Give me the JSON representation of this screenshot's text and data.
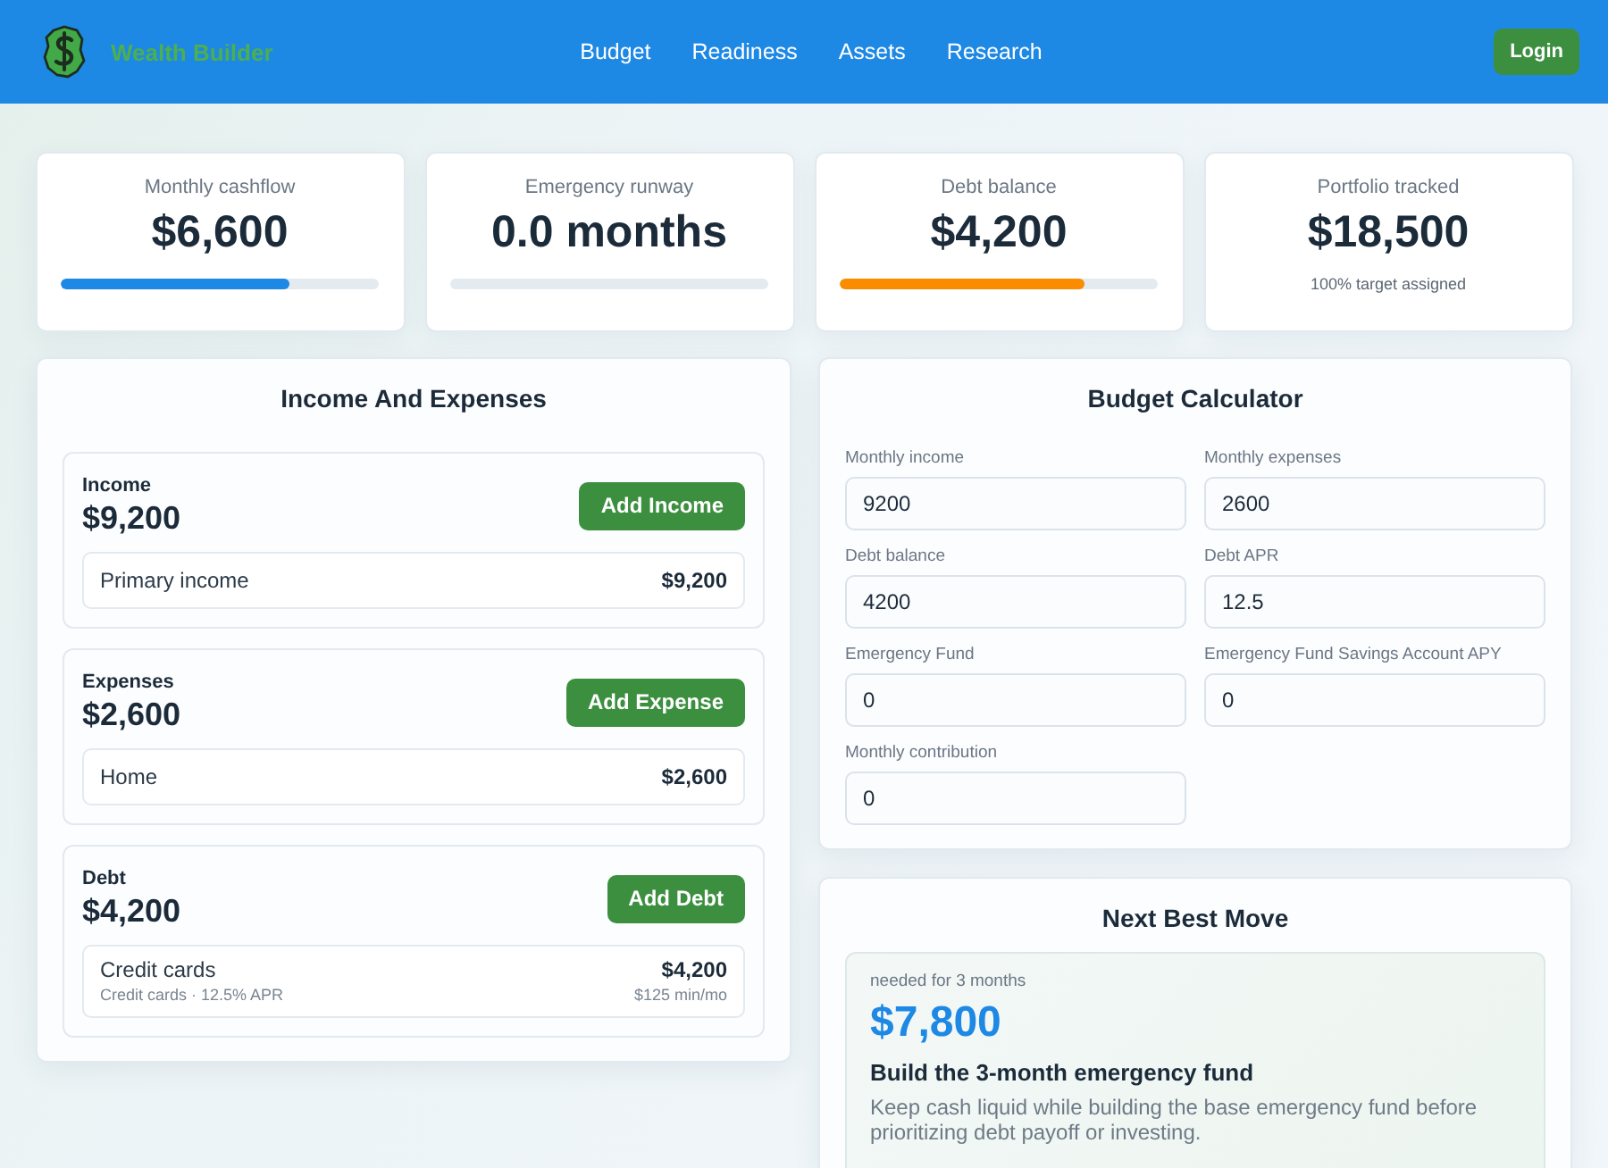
{
  "header": {
    "brand": "Wealth Builder",
    "nav": [
      "Budget",
      "Readiness",
      "Assets",
      "Research"
    ],
    "login": "Login"
  },
  "stats": [
    {
      "label": "Monthly cashflow",
      "value": "$6,600",
      "kind": "bar",
      "level": 0.72,
      "color": "#1e88e5"
    },
    {
      "label": "Emergency runway",
      "value": "0.0 months",
      "kind": "bar"
    },
    {
      "label": "Debt balance",
      "value": "$4,200",
      "kind": "bar",
      "level": 0.77,
      "color": "#fb8c00"
    },
    {
      "label": "Portfolio tracked",
      "value": "$18,500",
      "kind": "note",
      "note": "100% target assigned"
    }
  ],
  "ledger": {
    "title": "Income And Expenses",
    "sections": [
      {
        "label": "Income",
        "total": "$9,200",
        "button": "Add Income",
        "items": [
          {
            "name": "Primary income",
            "amount": "$9,200"
          }
        ]
      },
      {
        "label": "Expenses",
        "total": "$2,600",
        "button": "Add Expense",
        "items": [
          {
            "name": "Home",
            "amount": "$2,600"
          }
        ]
      },
      {
        "label": "Debt",
        "total": "$4,200",
        "button": "Add Debt",
        "items": [
          {
            "name": "Credit cards",
            "detail": "Credit cards · 12.5% APR",
            "amount": "$4,200",
            "sub_amount": "$125 min/mo"
          }
        ]
      }
    ]
  },
  "calculator": {
    "title": "Budget Calculator",
    "fields": [
      {
        "label": "Monthly income",
        "value": "9200"
      },
      {
        "label": "Monthly expenses",
        "value": "2600"
      },
      {
        "label": "Debt balance",
        "value": "4200"
      },
      {
        "label": "Debt APR",
        "value": "12.5"
      },
      {
        "label": "Emergency Fund",
        "value": "0"
      },
      {
        "label": "Emergency Fund Savings Account APY",
        "value": "0"
      },
      {
        "label": "Monthly contribution",
        "value": "0"
      }
    ]
  },
  "next_move": {
    "title": "Next Best Move",
    "caption": "needed for 3 months",
    "amount": "$7,800",
    "heading": "Build the 3-month emergency fund",
    "text": "Keep cash liquid while building the base emergency fund before prioritizing debt payoff or investing."
  }
}
